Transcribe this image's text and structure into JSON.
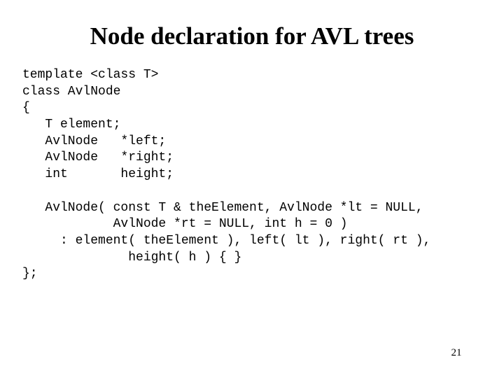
{
  "slide": {
    "title": "Node declaration for AVL trees",
    "code_lines": [
      "template <class T>",
      "class AvlNode",
      "{",
      "   T element;",
      "   AvlNode   *left;",
      "   AvlNode   *right;",
      "   int       height;",
      "",
      "   AvlNode( const T & theElement, AvlNode *lt = NULL,",
      "            AvlNode *rt = NULL, int h = 0 )",
      "     : element( theElement ), left( lt ), right( rt ),",
      "              height( h ) { }",
      "};"
    ],
    "page_number": "21"
  }
}
